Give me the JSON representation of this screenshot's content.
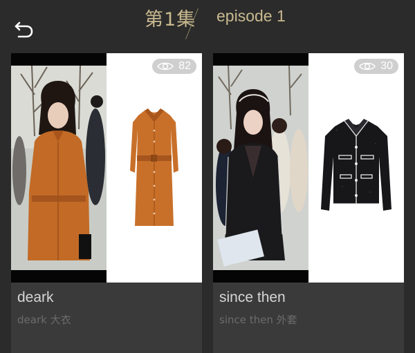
{
  "header": {
    "episode_cn": "第1集",
    "episode_en": "episode 1",
    "back_icon": "back-arrow-icon"
  },
  "colors": {
    "background": "#2b2b2b",
    "card": "#3a3a3a",
    "title_gold": "#c8b98f",
    "badge": "#cfcfcf"
  },
  "items": [
    {
      "title": "deark",
      "subtitle": "deark 大衣",
      "views": "82",
      "views_icon": "eye-icon",
      "garment": "orange belted shirt dress"
    },
    {
      "title": "since then",
      "subtitle": "since then 外套",
      "views": "30",
      "views_icon": "eye-icon",
      "garment": "black tweed jacket"
    }
  ]
}
